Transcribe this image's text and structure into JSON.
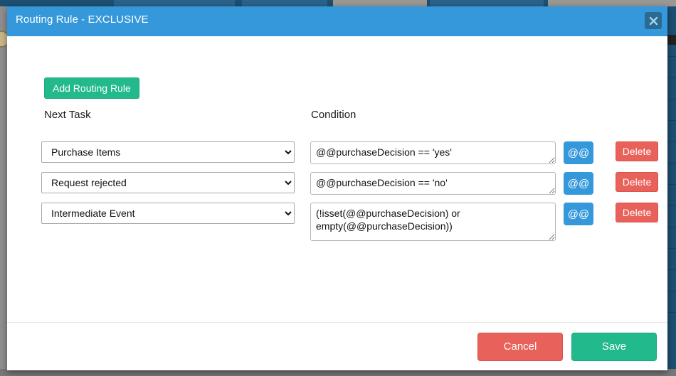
{
  "dialog": {
    "title": "Routing Rule - EXCLUSIVE",
    "close_icon": "close-icon"
  },
  "toolbar": {
    "add_rule_label": "Add Routing Rule"
  },
  "headers": {
    "next_task": "Next Task",
    "condition": "Condition"
  },
  "rules": [
    {
      "task": "Purchase Items",
      "condition": "@@purchaseDecision == 'yes'",
      "atat_label": "@@",
      "delete_label": "Delete"
    },
    {
      "task": "Request rejected",
      "condition": "@@purchaseDecision == 'no'",
      "atat_label": "@@",
      "delete_label": "Delete"
    },
    {
      "task": "Intermediate Event",
      "condition": "(!isset(@@purchaseDecision) or empty(@@purchaseDecision))",
      "atat_label": "@@",
      "delete_label": "Delete"
    }
  ],
  "footer": {
    "cancel_label": "Cancel",
    "save_label": "Save"
  },
  "colors": {
    "header_blue": "#3498db",
    "green": "#22b98c",
    "red": "#e8615a",
    "background_navy": "#1d4f72"
  }
}
